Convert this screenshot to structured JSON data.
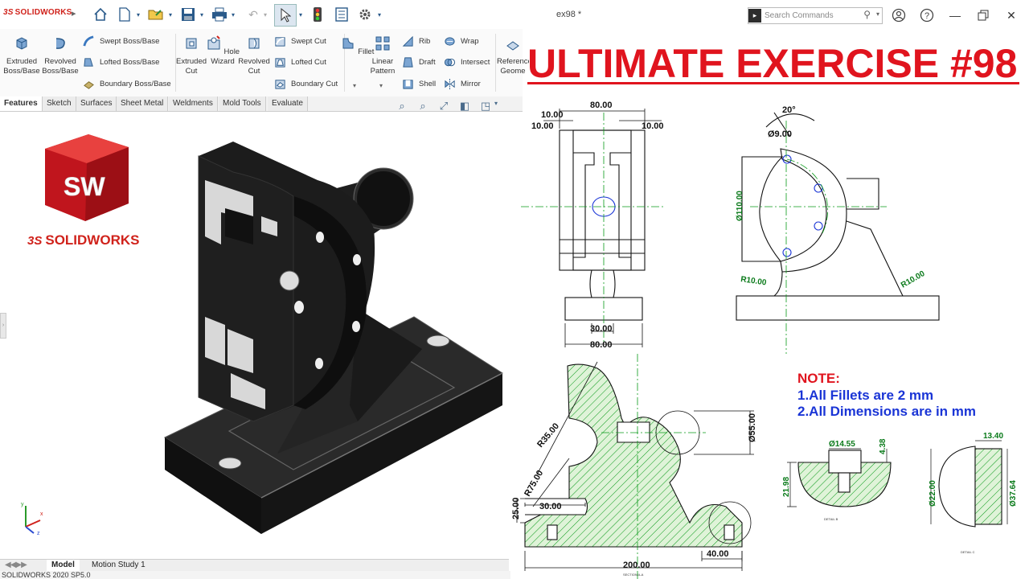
{
  "app": {
    "logo_text": "SOLIDWORKS",
    "doc_title": "ex98 *",
    "search_placeholder": "Search Commands"
  },
  "ribbon": {
    "extruded_boss": "Extruded Boss/Base",
    "revolved_boss": "Revolved Boss/Base",
    "swept_boss": "Swept Boss/Base",
    "lofted_boss": "Lofted Boss/Base",
    "boundary_boss": "Boundary Boss/Base",
    "extruded_cut": "Extruded Cut",
    "hole_wizard": "Hole Wizard",
    "revolved_cut": "Revolved Cut",
    "swept_cut": "Swept Cut",
    "lofted_cut": "Lofted Cut",
    "boundary_cut": "Boundary Cut",
    "fillet": "Fillet",
    "linear_pattern": "Linear Pattern",
    "rib": "Rib",
    "draft": "Draft",
    "shell": "Shell",
    "wrap": "Wrap",
    "intersect": "Intersect",
    "mirror": "Mirror",
    "reference_geometry": "Reference Geome"
  },
  "tabs": [
    "Features",
    "Sketch",
    "Surfaces",
    "Sheet Metal",
    "Weldments",
    "Mold Tools",
    "Evaluate"
  ],
  "bottom_tabs": [
    "Model",
    "Motion Study 1"
  ],
  "status_text": "SOLIDWORKS 2020 SP5.0",
  "brand": {
    "sw_letters": "SW",
    "solidworks_word": "SOLIDWORKS"
  },
  "banner": {
    "title": "ULTIMATE EXERCISE #98"
  },
  "note": {
    "heading": "NOTE:",
    "line1": "1.All Fillets are 2 mm",
    "line2": "2.All Dimensions are in mm"
  },
  "dims": {
    "top_width": "80.00",
    "left_offset": "10.00",
    "left_offset2": "10.00",
    "right_offset": "10.00",
    "bottom_inner": "30.00",
    "bottom_outer": "80.00",
    "angle": "20°",
    "hole_dia": "Ø9.00",
    "big_dia": "Ø110.00",
    "r10_left": "R10.00",
    "r10_right": "R10.00",
    "r35": "R35.00",
    "r75": "R75.00",
    "dia55": "Ø55.00",
    "h25": "25.00",
    "w30": "30.00",
    "w200": "200.00",
    "w40": "40.00",
    "d14": "Ø14.55",
    "h438": "4.38",
    "h2198": "21.98",
    "w1340": "13.40",
    "d22": "Ø22.00",
    "d3764": "Ø37.64"
  },
  "colors": {
    "banner_red": "#e0141e",
    "note_red": "#e0141e",
    "note_blue": "#1a35d6",
    "hatch_green": "#0a9a1a",
    "part_black": "#1a1a1a"
  }
}
